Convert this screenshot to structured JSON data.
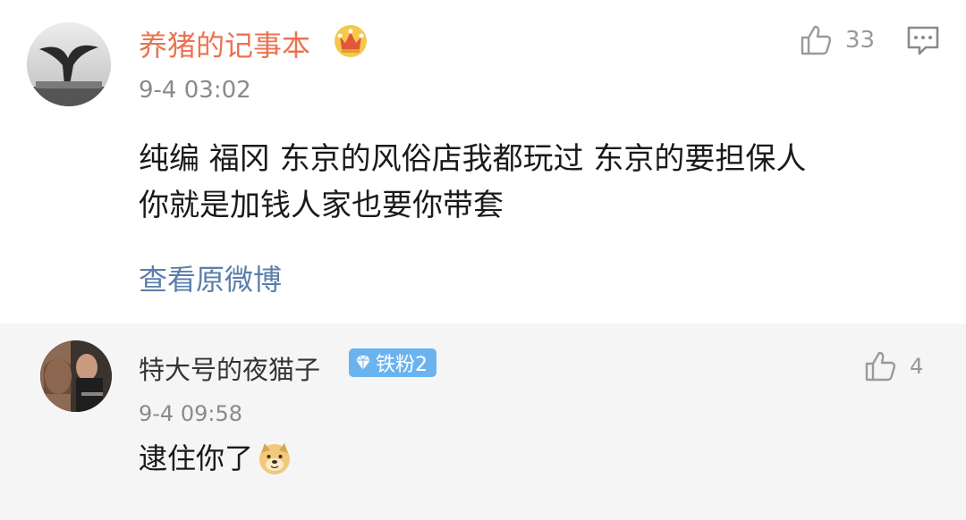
{
  "comments": [
    {
      "username": "养猪的记事本",
      "time": "9-4 03:02",
      "likes": "33",
      "text_line1": "纯编  福冈 东京的风俗店我都玩过 东京的要担保人",
      "text_line2": "你就是加钱人家也要你带套",
      "view_original": "查看原微博"
    },
    {
      "username": "特大号的夜猫子",
      "badge": "铁粉2",
      "time": "9-4 09:58",
      "likes": "4",
      "text": "逮住你了"
    }
  ],
  "colors": {
    "username_vip": "#eb7350",
    "link": "#5b7eaa",
    "badge": "#6bb3ef",
    "meta": "#8a8a8a"
  }
}
